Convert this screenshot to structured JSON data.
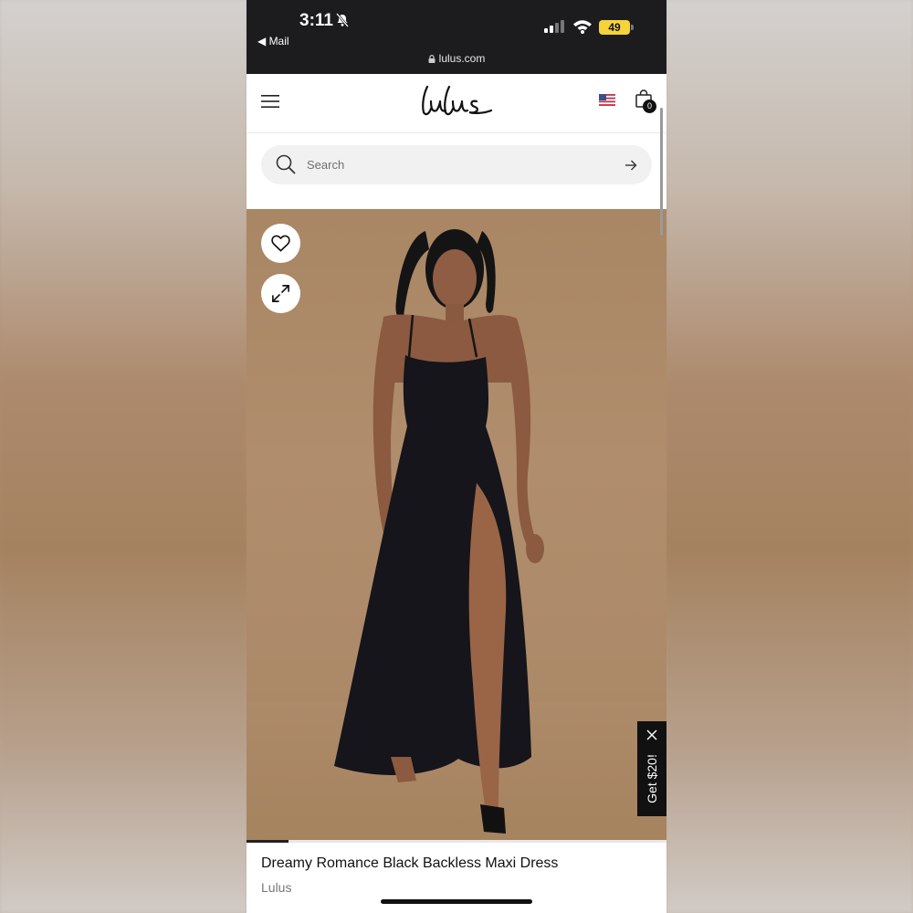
{
  "status_bar": {
    "time": "3:11",
    "back_label": "◀ Mail",
    "battery": "49",
    "url": "lulus.com"
  },
  "header": {
    "logo_text": "lulus",
    "cart_count": "0"
  },
  "search": {
    "placeholder": "Search"
  },
  "product": {
    "title": "Dreamy Romance Black Backless Maxi Dress",
    "brand": "Lulus",
    "image_position": "1 of 10"
  },
  "promo": {
    "label": "Get $20!"
  },
  "gallery": {
    "progress": 0.1
  },
  "icons": [
    "bell-slash-icon",
    "signal-icon",
    "wifi-icon",
    "lock-icon",
    "menu-icon",
    "us-flag-icon",
    "shopping-bag-icon",
    "search-icon",
    "arrow-right-icon",
    "heart-icon",
    "expand-icon",
    "close-icon"
  ],
  "colors": {
    "status_bg": "#1c1c1e",
    "battery": "#f5d33b",
    "image_bg": "#ad8a69",
    "dress": "#15151b"
  }
}
